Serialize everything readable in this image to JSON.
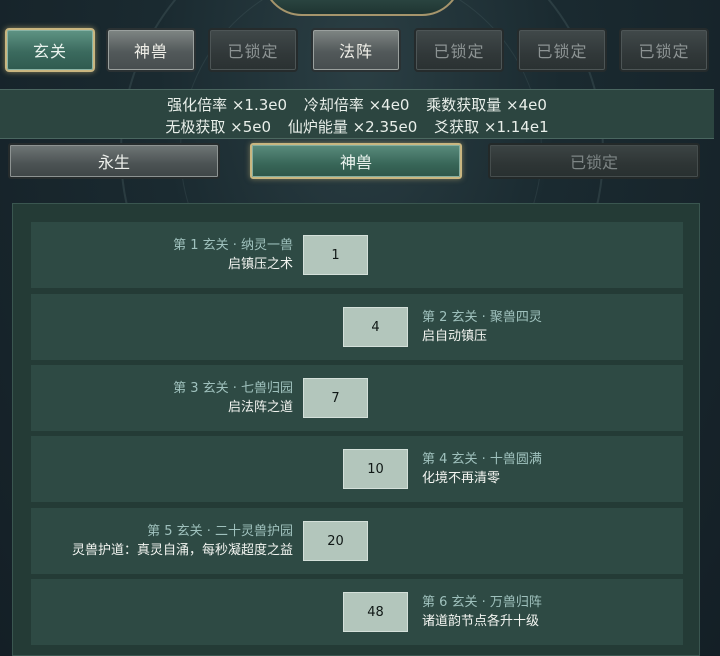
{
  "top_tabs": [
    {
      "label": "玄关",
      "state": "active"
    },
    {
      "label": "神兽",
      "state": "normal"
    },
    {
      "label": "已锁定",
      "state": "locked"
    },
    {
      "label": "法阵",
      "state": "normal"
    },
    {
      "label": "已锁定",
      "state": "locked"
    },
    {
      "label": "已锁定",
      "state": "locked"
    },
    {
      "label": "已锁定",
      "state": "locked"
    }
  ],
  "stats": {
    "line1": [
      "强化倍率 ×1.3e0",
      "冷却倍率 ×4e0",
      "乘数获取量 ×4e0"
    ],
    "line2": [
      "无极获取 ×5e0",
      "仙炉能量 ×2.35e0",
      "爻获取 ×1.14e1"
    ]
  },
  "sub_tabs": [
    {
      "label": "永生",
      "state": "normal"
    },
    {
      "label": "神兽",
      "state": "active"
    },
    {
      "label": "已锁定",
      "state": "locked"
    }
  ],
  "milestones": [
    {
      "requirement": "1",
      "title": "第 1 玄关 · 纳灵一兽",
      "desc": "启镇压之术"
    },
    {
      "requirement": "4",
      "title": "第 2 玄关 · 聚兽四灵",
      "desc": "启自动镇压"
    },
    {
      "requirement": "7",
      "title": "第 3 玄关 · 七兽归园",
      "desc": "启法阵之道"
    },
    {
      "requirement": "10",
      "title": "第 4 玄关 · 十兽圆满",
      "desc": "化境不再清零"
    },
    {
      "requirement": "20",
      "title": "第 5 玄关 · 二十灵兽护园",
      "desc": "灵兽护道：真灵自涌，每秒凝超度之益"
    },
    {
      "requirement": "48",
      "title": "第 6 玄关 · 万兽归阵",
      "desc": "诸道韵节点各升十级"
    }
  ],
  "colors": {
    "active_tab": "#3b6a5e",
    "gold_border": "#c9b680",
    "panel": "#243b36",
    "row": "#2e4a44",
    "req_box": "#b3c6bc",
    "title_text": "#9fc1bd"
  }
}
